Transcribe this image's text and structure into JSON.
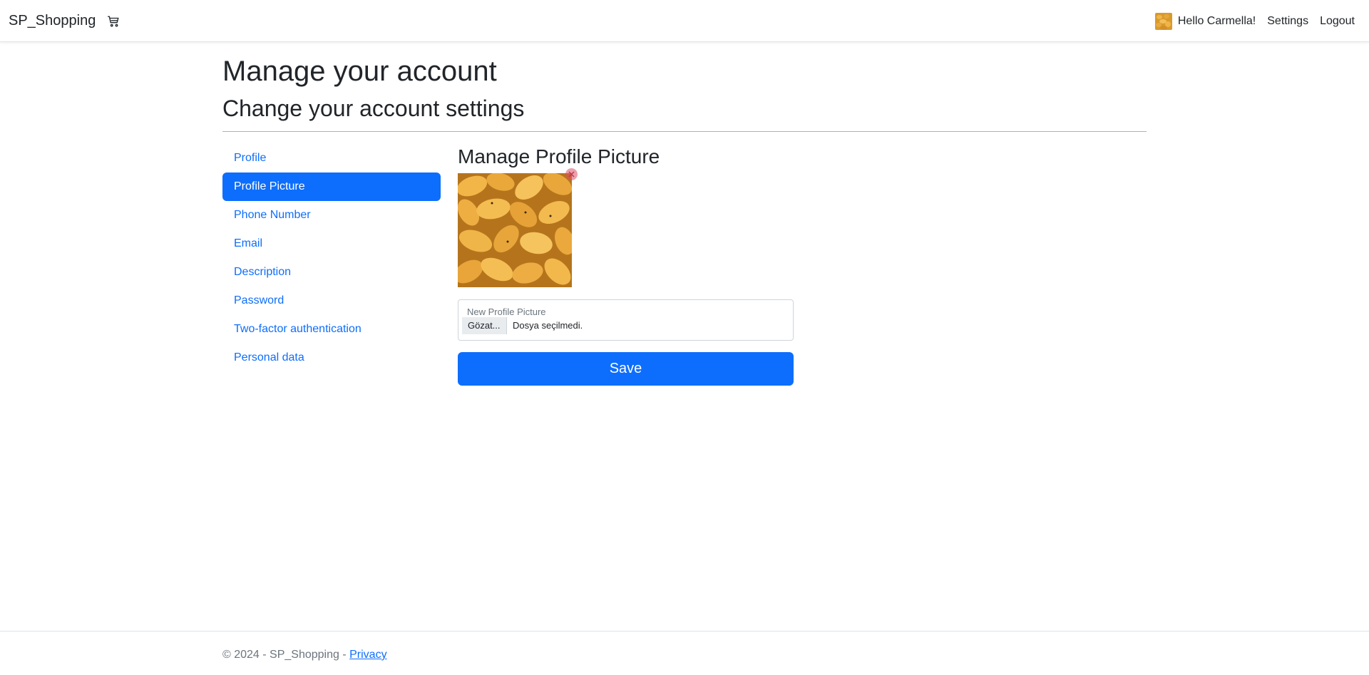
{
  "navbar": {
    "brand": "SP_Shopping",
    "cart_icon": "cart-icon",
    "greeting": "Hello Carmella!",
    "settings_label": "Settings",
    "logout_label": "Logout"
  },
  "header": {
    "title": "Manage your account",
    "subtitle": "Change your account settings"
  },
  "sidenav": {
    "items": [
      {
        "label": "Profile",
        "active": false
      },
      {
        "label": "Profile Picture",
        "active": true
      },
      {
        "label": "Phone Number",
        "active": false
      },
      {
        "label": "Email",
        "active": false
      },
      {
        "label": "Description",
        "active": false
      },
      {
        "label": "Password",
        "active": false
      },
      {
        "label": "Two-factor authentication",
        "active": false
      },
      {
        "label": "Personal data",
        "active": false
      }
    ]
  },
  "main": {
    "title": "Manage Profile Picture",
    "file_label": "New Profile Picture",
    "file_button": "Gözat...",
    "file_status": "Dosya seçilmedi.",
    "save_label": "Save"
  },
  "footer": {
    "copyright": "© 2024 - SP_Shopping - ",
    "privacy_label": "Privacy"
  },
  "colors": {
    "primary": "#0d6efd",
    "text": "#212529",
    "muted": "#6c757d"
  }
}
